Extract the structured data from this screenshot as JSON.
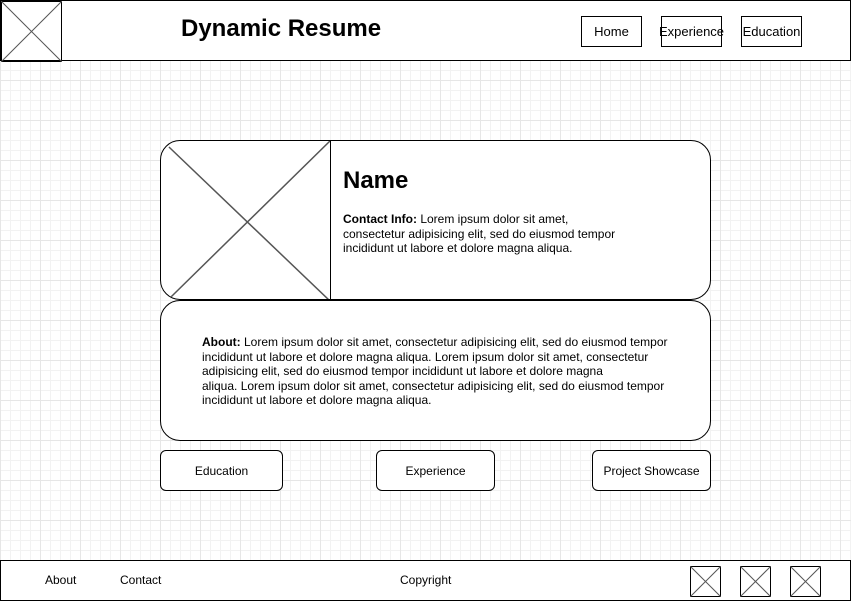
{
  "header": {
    "title": "Dynamic Resume",
    "nav": [
      "Home",
      "Experience",
      "Education"
    ]
  },
  "profile": {
    "name": "Name",
    "contact_label": "Contact Info:",
    "contact_lines": [
      " Lorem ipsum dolor sit amet,",
      "consectetur adipisicing elit, sed do eiusmod tempor",
      "incididunt ut labore et dolore magna aliqua."
    ]
  },
  "about": {
    "label": "About:",
    "lines": [
      " Lorem ipsum dolor sit amet, consectetur adipisicing elit, sed do eiusmod tempor",
      "incididunt ut labore et dolore magna aliqua. Lorem ipsum dolor sit amet, consectetur",
      "adipisicing elit, sed do eiusmod tempor incididunt ut labore et dolore magna",
      "aliqua. Lorem ipsum dolor sit amet, consectetur adipisicing elit, sed do eiusmod tempor",
      "incididunt ut labore et dolore magna aliqua."
    ]
  },
  "sections": [
    "Education",
    "Experience",
    "Project Showcase"
  ],
  "footer": {
    "links": [
      "About",
      "Contact"
    ],
    "copyright": "Copyright"
  }
}
